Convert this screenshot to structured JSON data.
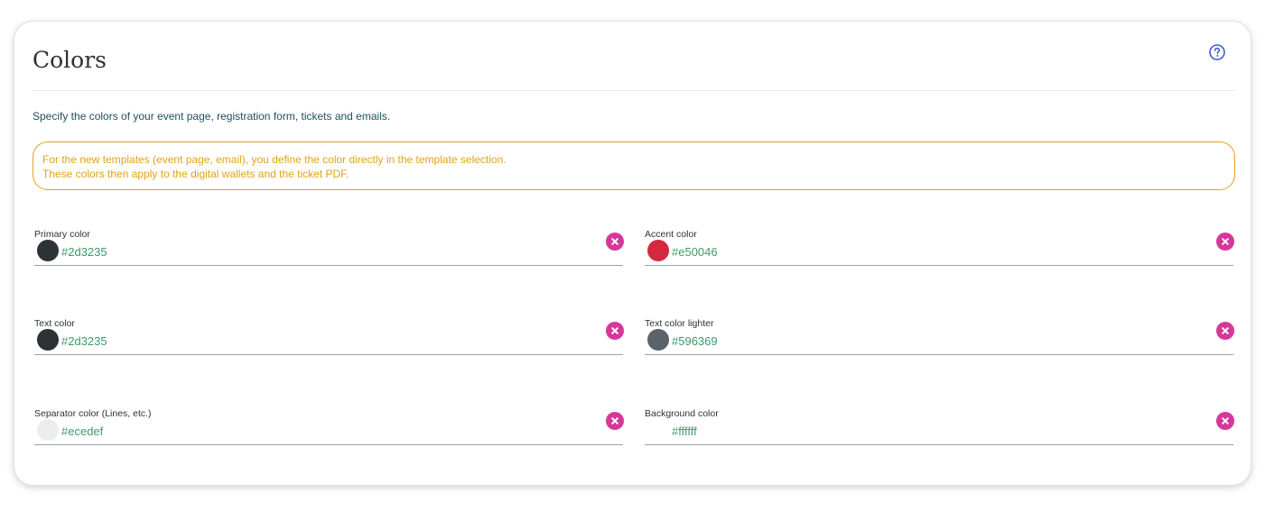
{
  "panel": {
    "title": "Colors",
    "help_icon": "question-circle-icon",
    "description": "Specify the colors of your event page, registration form, tickets and emails.",
    "notice_lines": [
      "For the new templates (event page, email), you define the color directly in the template selection.",
      "These colors then apply to the digital wallets and the ticket PDF."
    ]
  },
  "fields": [
    {
      "label": "Primary color",
      "value": "#2d3235",
      "swatch": "#2d3235"
    },
    {
      "label": "Accent color",
      "value": "#e50046",
      "swatch": "#d42a3f"
    },
    {
      "label": "Text color",
      "value": "#2d3235",
      "swatch": "#2d3235"
    },
    {
      "label": "Text color lighter",
      "value": "#596369",
      "swatch": "#596369"
    },
    {
      "label": "Separator color (Lines, etc.)",
      "value": "#ecedef",
      "swatch": "#ecedef"
    },
    {
      "label": "Background color",
      "value": "#ffffff",
      "swatch": "#ffffff"
    }
  ],
  "colors": {
    "notice": "#e3a21a",
    "value_text": "#3d9a6c",
    "clear_button": "#d6389a",
    "help_icon": "#3f5bd1"
  },
  "icons": {
    "clear": "close-circle-icon"
  }
}
